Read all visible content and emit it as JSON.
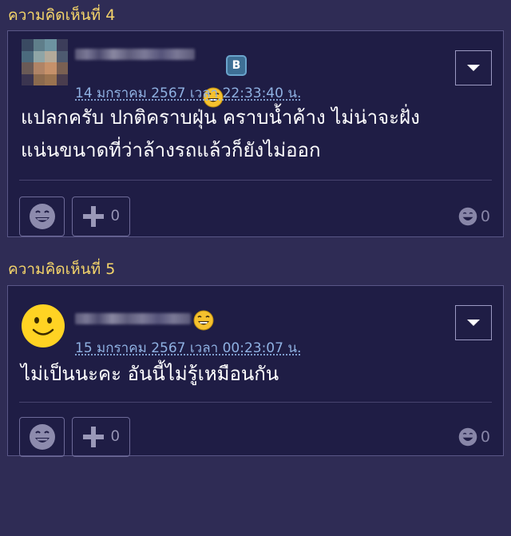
{
  "comments": [
    {
      "heading": "ความคิดเห็นที่ 4",
      "timestamp": "14 มกราคม 2567 เวลา 22:33:40 น.",
      "body_lines": [
        "แปลกครับ ปกติคราบฝุ่น คราบน้ำค้าง ไม่น่าจะฝั่ง",
        "แน่นขนาดที่ว่าล้างรถแล้วก็ยังไม่ออก"
      ],
      "plus_count": "0",
      "reaction_count": "0",
      "badges": [
        "laughing-emoji",
        "blogger-badge-b"
      ],
      "badge_b_label": "B",
      "avatar": "pixelated-photo"
    },
    {
      "heading": "ความคิดเห็นที่ 5",
      "timestamp": "15 มกราคม 2567 เวลา 00:23:07 น.",
      "body_lines": [
        "ไม่เป็นนะคะ อันนี้ไม่รู้เหมือนกัน"
      ],
      "plus_count": "0",
      "reaction_count": "0",
      "badges": [
        "laughing-emoji"
      ],
      "avatar": "yellow-smiley"
    }
  ],
  "colors": {
    "background": "#2f2c55",
    "card": "#1f1d45",
    "heading": "#f5d56a",
    "timestamp": "#8fb1e2",
    "border": "#5a5787"
  }
}
